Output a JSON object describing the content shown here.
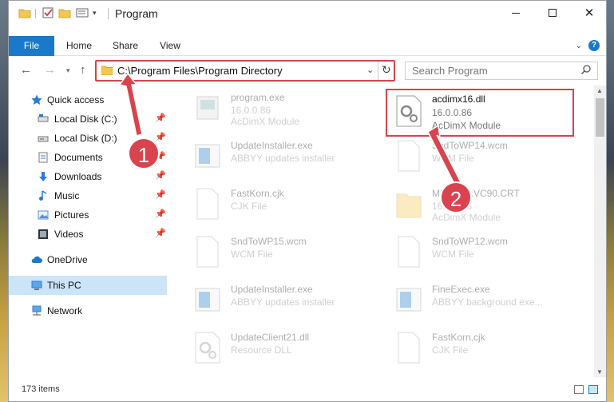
{
  "window": {
    "title": "Program",
    "colors": {
      "accent": "#1979ca",
      "highlight": "#d9434d",
      "selected": "#cce4f7"
    }
  },
  "ribbon": {
    "file": "File",
    "home": "Home",
    "share": "Share",
    "view": "View"
  },
  "address": {
    "path": "C:\\Program Files\\Program Directory"
  },
  "search": {
    "placeholder": "Search Program"
  },
  "sidebar": {
    "items": [
      {
        "label": "Quick access",
        "icon": "star-icon"
      },
      {
        "label": "Local Disk (C:)",
        "icon": "drive-icon",
        "pinned": true
      },
      {
        "label": "Local Disk (D:)",
        "icon": "drive-icon",
        "pinned": true
      },
      {
        "label": "Documents",
        "icon": "documents-icon",
        "pinned": true
      },
      {
        "label": "Downloads",
        "icon": "download-icon",
        "pinned": true
      },
      {
        "label": "Music",
        "icon": "music-icon",
        "pinned": true
      },
      {
        "label": "Pictures",
        "icon": "pictures-icon",
        "pinned": true
      },
      {
        "label": "Videos",
        "icon": "videos-icon",
        "pinned": true
      },
      {
        "label": "OneDrive",
        "icon": "cloud-icon"
      },
      {
        "label": "This PC",
        "icon": "computer-icon",
        "selected": true
      },
      {
        "label": "Network",
        "icon": "network-icon"
      }
    ]
  },
  "files": [
    {
      "name": "program.exe",
      "line1": "16.0.0.86",
      "line2": "AcDimX Module",
      "icon": "exe-icon"
    },
    {
      "name": "acdimx16.dll",
      "line1": "16.0.0.86",
      "line2": "AcDimX Module",
      "icon": "dll-icon",
      "highlight": true
    },
    {
      "name": "UpdateInstaller.exe",
      "line1": "ABBYY updates installer",
      "line2": "",
      "icon": "installer-icon"
    },
    {
      "name": "SndToWP14.wcm",
      "line1": "WCM File",
      "line2": "",
      "icon": "file-icon"
    },
    {
      "name": "FastKorn.cjk",
      "line1": "CJK File",
      "line2": "",
      "icon": "file-icon"
    },
    {
      "name": "Microsoft.VC90.CRT",
      "line1": "16.0.0.86",
      "line2": "AcDimX Module",
      "icon": "folder-icon"
    },
    {
      "name": "SndToWP15.wcm",
      "line1": "WCM File",
      "line2": "",
      "icon": "file-icon"
    },
    {
      "name": "SndToWP12.wcm",
      "line1": "WCM File",
      "line2": "",
      "icon": "file-icon"
    },
    {
      "name": "UpdateInstaller.exe",
      "line1": "ABBYY updates installer",
      "line2": "",
      "icon": "installer-icon"
    },
    {
      "name": "FineExec.exe",
      "line1": "ABBYY background exe...",
      "line2": "",
      "icon": "installer-icon"
    },
    {
      "name": "UpdateClient21.dll",
      "line1": "Resource DLL",
      "line2": "",
      "icon": "dll-icon"
    },
    {
      "name": "FastKorn.cjk",
      "line1": "CJK File",
      "line2": "",
      "icon": "file-icon"
    }
  ],
  "status": {
    "count": "173 items"
  },
  "annotations": [
    {
      "label": "1"
    },
    {
      "label": "2"
    }
  ]
}
